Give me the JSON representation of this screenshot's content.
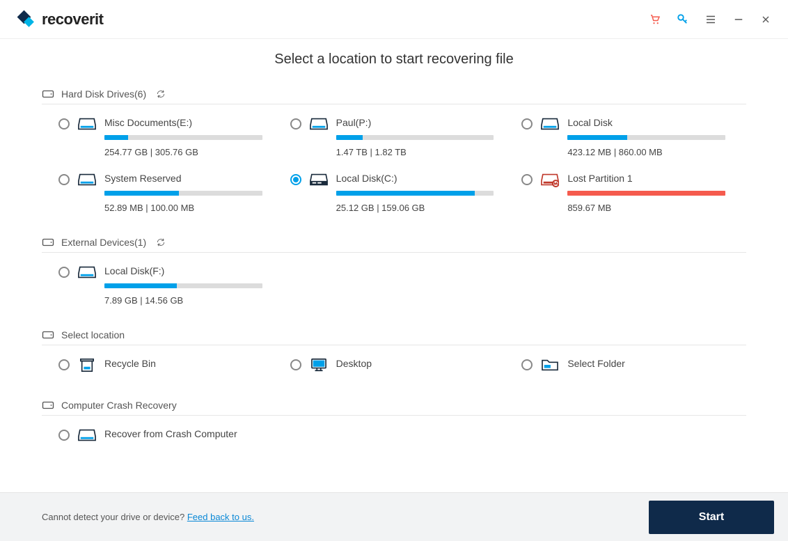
{
  "app": {
    "name": "recoverit"
  },
  "header": {
    "title": "Select a location to start recovering file"
  },
  "sections": {
    "hdd": {
      "label": "Hard Disk Drives(6)",
      "items": [
        {
          "label": "Misc Documents(E:)",
          "size": "254.77  GB | 305.76  GB",
          "fill": 15,
          "icon": "disk",
          "selected": false
        },
        {
          "label": "Paul(P:)",
          "size": "1.47  TB | 1.82  TB",
          "fill": 17,
          "icon": "disk",
          "selected": false
        },
        {
          "label": "Local Disk",
          "size": "423.12  MB | 860.00  MB",
          "fill": 38,
          "icon": "disk",
          "selected": false
        },
        {
          "label": "System Reserved",
          "size": "52.89  MB | 100.00  MB",
          "fill": 47,
          "icon": "disk",
          "selected": false
        },
        {
          "label": "Local Disk(C:)",
          "size": "25.12  GB | 159.06  GB",
          "fill": 88,
          "icon": "system",
          "selected": true
        },
        {
          "label": "Lost Partition 1",
          "size": "859.67  MB",
          "fill": 100,
          "icon": "lost",
          "color": "red",
          "selected": false
        }
      ]
    },
    "external": {
      "label": "External Devices(1)",
      "items": [
        {
          "label": "Local Disk(F:)",
          "size": "7.89  GB | 14.56  GB",
          "fill": 46,
          "icon": "disk",
          "selected": false
        }
      ]
    },
    "location": {
      "label": "Select location",
      "items": [
        {
          "label": "Recycle Bin",
          "icon": "recycle",
          "selected": false
        },
        {
          "label": "Desktop",
          "icon": "desktop",
          "selected": false
        },
        {
          "label": "Select Folder",
          "icon": "folder",
          "selected": false
        }
      ]
    },
    "crash": {
      "label": "Computer Crash Recovery",
      "items": [
        {
          "label": "Recover from Crash Computer",
          "icon": "disk",
          "selected": false
        }
      ]
    }
  },
  "footer": {
    "prompt": "Cannot detect your drive or device? ",
    "link": "Feed back to us.",
    "start": "Start"
  }
}
